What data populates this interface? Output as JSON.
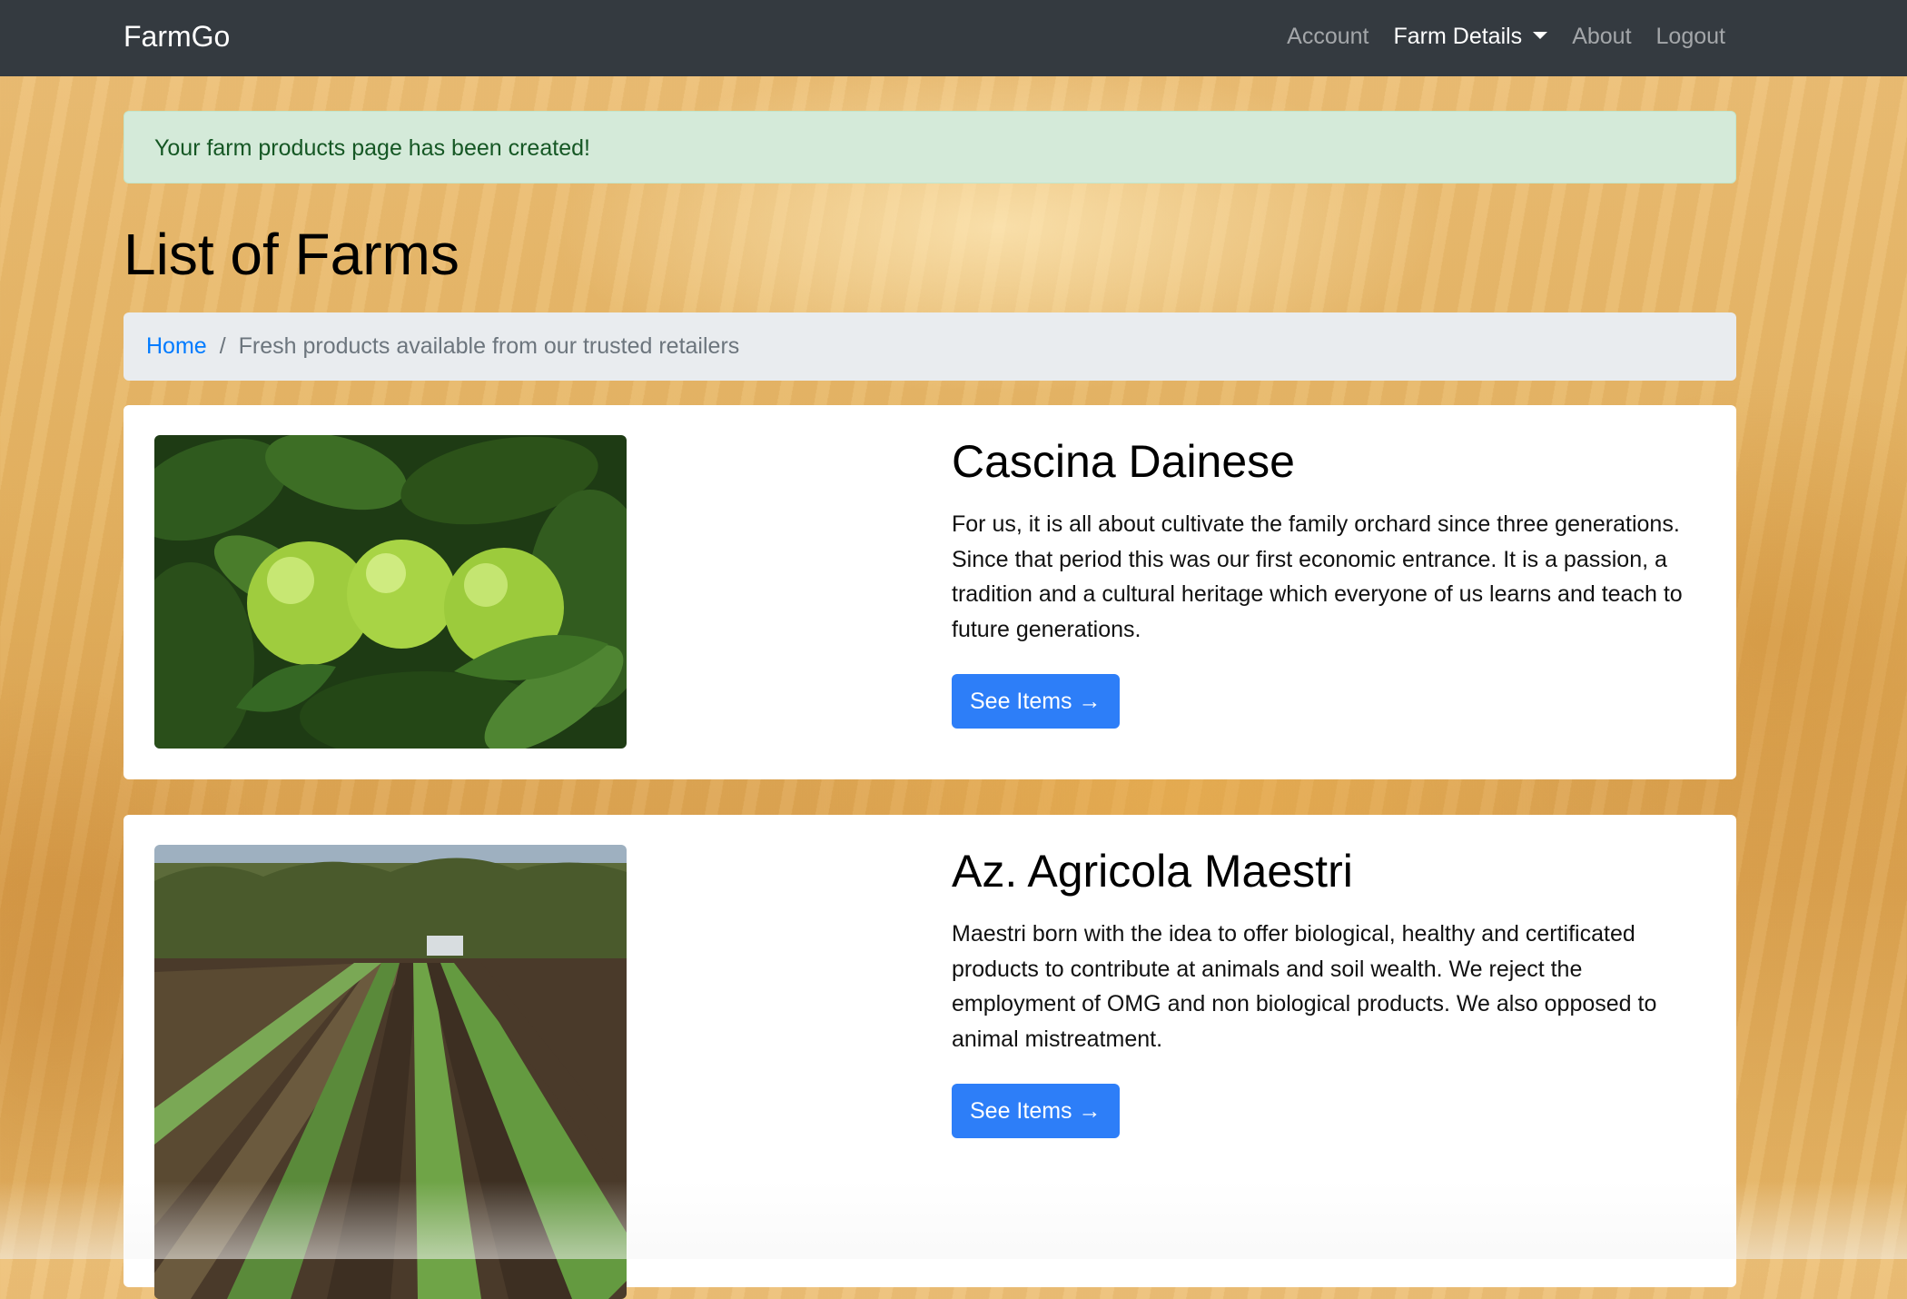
{
  "navbar": {
    "brand": "FarmGo",
    "links": [
      {
        "label": "Account"
      },
      {
        "label": "Farm Details"
      },
      {
        "label": "About"
      },
      {
        "label": "Logout"
      }
    ]
  },
  "alert": {
    "message": "Your farm products page has been created!"
  },
  "page": {
    "title": "List of Farms"
  },
  "breadcrumb": {
    "home": "Home",
    "separator": "/",
    "current": "Fresh products available from our trusted retailers"
  },
  "farms": [
    {
      "name": "Cascina Dainese",
      "description": "For us, it is all about cultivate the family orchard since three generations. Since that period this was our first economic entrance. It is a passion, a tradition and a cultural heritage which everyone of us learns and teach to future generations.",
      "button_label": "See Items →"
    },
    {
      "name": "Az. Agricola Maestri",
      "description": "Maestri born with the idea to offer biological, healthy and certificated products to contribute at animals and soil wealth. We reject the employment of OMG and non biological products. We also opposed to animal mistreatment.",
      "button_label": "See Items →"
    }
  ],
  "colors": {
    "navbar": "#343a40",
    "primary": "#2d7ef8",
    "alert_bg": "#d4ead9",
    "alert_text": "#155724"
  }
}
